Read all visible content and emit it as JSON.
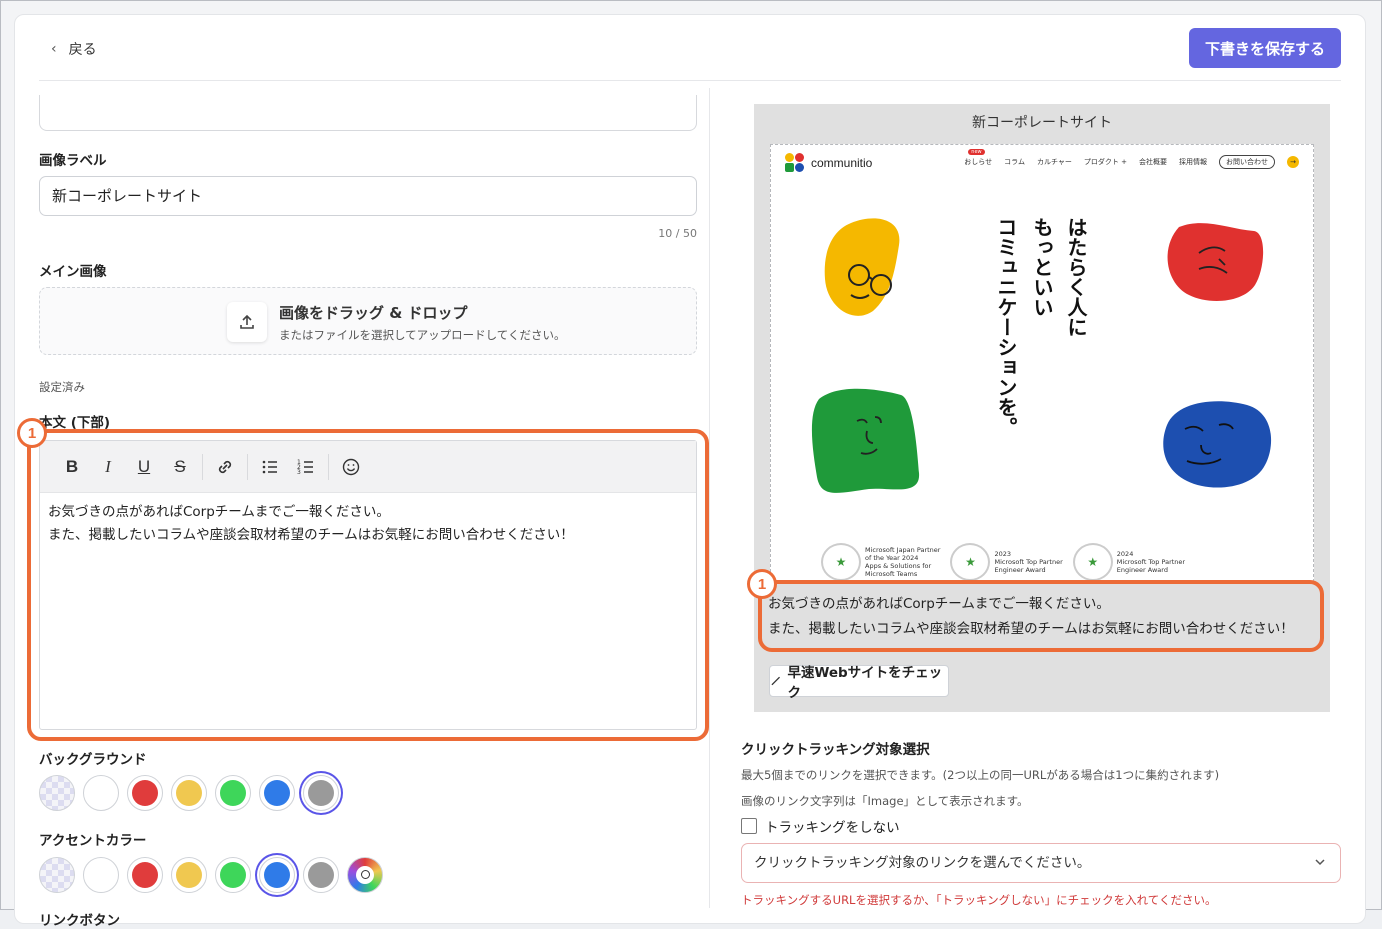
{
  "header": {
    "back_label": "戻る",
    "save_label": "下書きを保存する"
  },
  "form": {
    "image_label": {
      "label": "画像ラベル",
      "value": "新コーポレートサイト",
      "counter": "10 / 50"
    },
    "main_image": {
      "label": "メイン画像",
      "drop_title": "画像をドラッグ & ドロップ",
      "drop_sub": "またはファイルを選択してアップロードしてください。",
      "status": "設定済み"
    },
    "body": {
      "label": "本文 (下部)",
      "line1": "お気づきの点があればCorpチームまでご一報ください。",
      "line2": "また、掲載したいコラムや座談会取材希望のチームはお気軽にお問い合わせください！"
    },
    "background": {
      "label": "バックグラウンド",
      "colors": [
        "transparent",
        "#ffffff",
        "#e03c3c",
        "#f0c850",
        "#3ed65a",
        "#2f7be8",
        "#9a9a9a"
      ],
      "selected": 6
    },
    "accent": {
      "label": "アクセントカラー",
      "colors": [
        "transparent",
        "#ffffff",
        "#e03c3c",
        "#f0c850",
        "#3ed65a",
        "#2f7be8",
        "#9a9a9a",
        "custom"
      ],
      "selected": 5
    },
    "link_button": {
      "label": "リンクボタン"
    }
  },
  "annotation": {
    "badge": "1"
  },
  "preview": {
    "title": "新コーポレートサイト",
    "site": {
      "logo": "communitio",
      "nav": [
        "おしらせ",
        "コラム",
        "カルチャー",
        "プロダクト +",
        "会社概要",
        "採用情報",
        "お問い合わせ"
      ],
      "headline_col1": "はたらく人に",
      "headline_col2": "もっといい",
      "headline_col3": "コミュニケーションを。",
      "awards": [
        {
          "l1": "Microsoft Japan Partner",
          "l2": "of the Year 2024",
          "l3": "Apps & Solutions for",
          "l4": "Microsoft Teams"
        },
        {
          "l1": "2023",
          "l2": "Microsoft Top Partner",
          "l3": "Engineer Award",
          "l4": ""
        },
        {
          "l1": "2024",
          "l2": "Microsoft Top Partner",
          "l3": "Engineer Award",
          "l4": ""
        }
      ]
    },
    "caption_line1": "お気づきの点があればCorpチームまでご一報ください。",
    "caption_line2": "また、掲載したいコラムや座談会取材希望のチームはお気軽にお問い合わせください！",
    "check_button": "早速Webサイトをチェック"
  },
  "tracking": {
    "title": "クリックトラッキング対象選択",
    "note1": "最大5個までのリンクを選択できます。(2つ以上の同一URLがある場合は1つに集約されます)",
    "note2": "画像のリンク文字列は「Image」として表示されます。",
    "no_tracking_label": "トラッキングをしない",
    "select_placeholder": "クリックトラッキング対象のリンクを選んでください。",
    "error": "トラッキングするURLを選択するか、「トラッキングしない」にチェックを入れてください。"
  }
}
